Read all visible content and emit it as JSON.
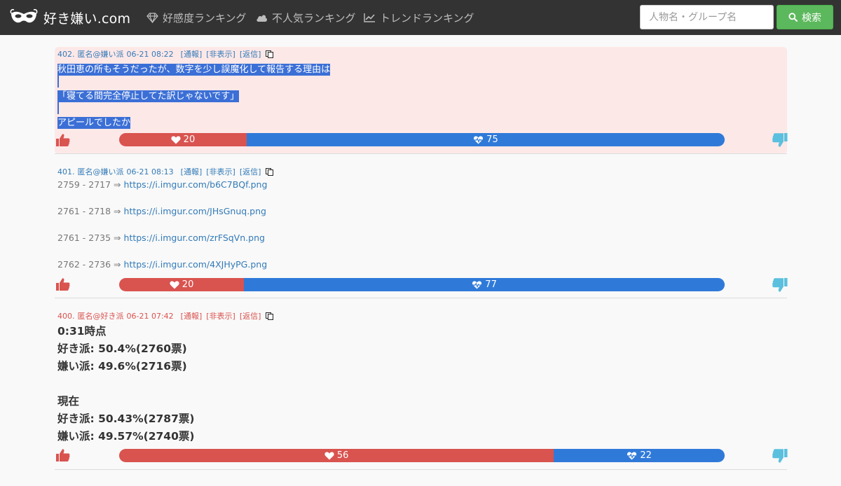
{
  "header": {
    "brand": "好き嫌い.com",
    "nav": [
      {
        "label": "好感度ランキング",
        "icon": "diamond-icon"
      },
      {
        "label": "不人気ランキング",
        "icon": "cloud-icon"
      },
      {
        "label": "トレンドランキング",
        "icon": "line-chart-icon"
      }
    ],
    "search": {
      "placeholder": "人物名・グループ名",
      "value": "",
      "button_label": "検索"
    }
  },
  "colors": {
    "navbar": "#333333",
    "like": "#d9534f",
    "dislike": "#2f7ad9",
    "search_button": "#5cb85c",
    "highlight": "#fde8e8",
    "selection": "#3b6fd6"
  },
  "posts": [
    {
      "number": "402.",
      "author": "匿名@嫌い派",
      "date": "06-21 08:22",
      "actions": [
        "[通報]",
        "[非表示]",
        "[返信]"
      ],
      "lines": [
        "秋田恵の所もそうだったが、数字を少し誤魔化して報告する理由は",
        "",
        "「寝てる間完全停止してた訳じゃないです」",
        "",
        "アピールでしたか"
      ],
      "likes": 20,
      "dislikes": 75
    },
    {
      "number": "401.",
      "author": "匿名@嫌い派",
      "date": "06-21 08:13",
      "actions": [
        "[通報]",
        "[非表示]",
        "[返信]"
      ],
      "links": [
        {
          "prefix": "2759 - 2717 ⇒ ",
          "url": "https://i.imgur.com/b6C7BQf.png"
        },
        {
          "prefix": "2761 - 2718 ⇒ ",
          "url": "https://i.imgur.com/JHsGnuq.png"
        },
        {
          "prefix": "2761 - 2735 ⇒ ",
          "url": "https://i.imgur.com/zrFSqVn.png"
        },
        {
          "prefix": "2762 - 2736 ⇒ ",
          "url": "https://i.imgur.com/4XJHyPG.png"
        }
      ],
      "likes": 20,
      "dislikes": 77
    },
    {
      "number": "400.",
      "author": "匿名@好き派",
      "date": "06-21 07:42",
      "actions": [
        "[通報]",
        "[非表示]",
        "[返信]"
      ],
      "lines": [
        "0:31時点",
        "好き派: 50.4%(2760票)",
        "嫌い派: 49.6%(2716票)",
        "",
        "現在",
        "好き派: 50.43%(2787票)",
        "嫌い派: 49.57%(2740票)"
      ],
      "likes": 56,
      "dislikes": 22
    }
  ]
}
